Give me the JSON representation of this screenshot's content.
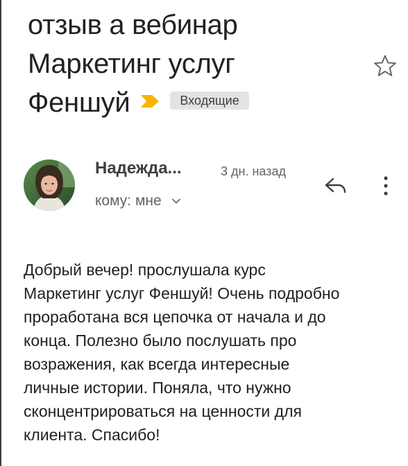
{
  "message": {
    "subject_lines": [
      "отзыв а вебинар",
      "Маркетинг услуг",
      "Феншуй"
    ],
    "label": "Входящие",
    "importance_marker": "importance-marker-icon",
    "star": "star-outline-icon"
  },
  "header": {
    "sender_name": "Надежда...",
    "time": "3 дн. назад",
    "recipient": "кому: мне",
    "reply_icon": "reply-icon",
    "more_icon": "more-vertical-icon",
    "recipient_toggle_icon": "chevron-down-icon"
  },
  "body": {
    "lines": [
      "Добрый вечер! прослушала курс",
      "Маркетинг услуг Феншуй! Очень подробно",
      "проработана вся цепочка от начала и до",
      "конца. Полезно было послушать про",
      "возражения, как всегда интересные",
      "личные истории. Поняла, что нужно",
      "сконцентрироваться на ценности для",
      "клиента. Спасибо!"
    ]
  },
  "colors": {
    "importance": "#f4b400",
    "text_primary": "#202124",
    "text_secondary": "#5f6368",
    "chip_bg": "#e3e3e3"
  }
}
